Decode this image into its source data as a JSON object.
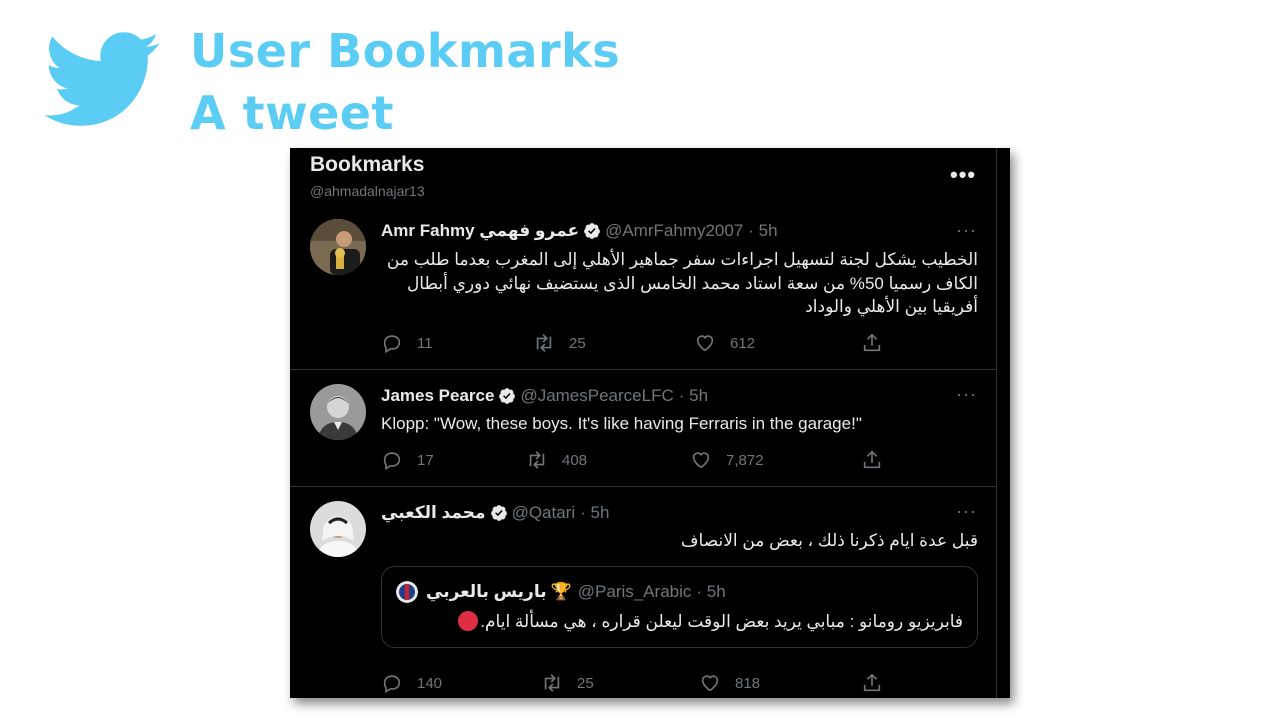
{
  "slide": {
    "title_line1": "User Bookmarks",
    "title_line2": "A tweet"
  },
  "colors": {
    "accent": "#5bcdf5",
    "background": "#000000",
    "text": "#e7e9ea",
    "muted": "#71767b",
    "border": "#2f3336",
    "verified": "#e7e9ea",
    "red_emoji": "#dd2e44"
  },
  "header": {
    "title": "Bookmarks",
    "handle": "@ahmadalnajar13",
    "more_icon": "more-icon",
    "more_glyph": "•••"
  },
  "tweets": [
    {
      "name": "Amr Fahmy عمرو فهمي",
      "handle": "@AmrFahmy2007",
      "time": "· 5h",
      "more": "···",
      "text": "الخطيب يشكل لجنة لتسهيل اجراءات سفر جماهير الأهلي إلى المغرب بعدما طلب من الكاف رسميا 50% من سعة استاد محمد الخامس الذى يستضيف نهائي دوري أبطال أفريقيا بين الأهلي والوداد",
      "replies": "11",
      "retweets": "25",
      "likes": "612"
    },
    {
      "name": "James Pearce",
      "handle": "@JamesPearceLFC",
      "time": "· 5h",
      "more": "···",
      "text": "Klopp: \"Wow, these boys. It's like having Ferraris in the garage!\"",
      "replies": "17",
      "retweets": "408",
      "likes": "7,872"
    },
    {
      "name": "محمد الكعبي",
      "handle": "@Qatari",
      "time": "· 5h",
      "more": "···",
      "text": "قبل عدة ايام ذكرنا ذلك ، بعض من الانصاف",
      "quote": {
        "name": "باريس بالعربي",
        "emoji": "🏆",
        "handle": "@Paris_Arabic",
        "time": "· 5h",
        "text": "فابريزيو رومانو : مبابي يريد بعض الوقت ليعلن قراره ، هي مسألة ايام."
      },
      "replies": "140",
      "retweets": "25",
      "likes": "818"
    }
  ]
}
